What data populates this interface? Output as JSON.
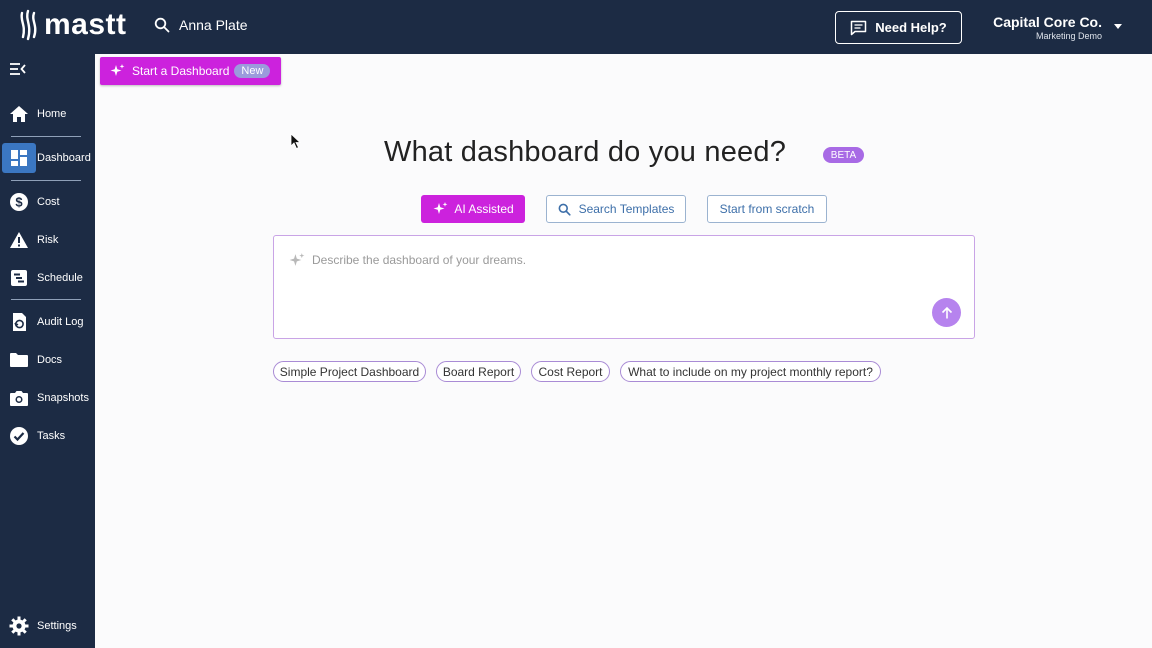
{
  "app": {
    "logo_text": "mastt"
  },
  "header": {
    "search_value": "Anna Plate",
    "help_label": "Need Help?",
    "company_name": "Capital Core Co.",
    "company_sub": "Marketing Demo"
  },
  "sidebar": {
    "items": [
      {
        "label": "Home",
        "icon": "home-icon"
      },
      {
        "label": "Dashboard",
        "icon": "dashboard-icon",
        "active": true
      },
      {
        "label": "Cost",
        "icon": "dollar-icon"
      },
      {
        "label": "Risk",
        "icon": "warning-icon"
      },
      {
        "label": "Schedule",
        "icon": "schedule-icon"
      },
      {
        "label": "Audit Log",
        "icon": "history-icon"
      },
      {
        "label": "Docs",
        "icon": "folder-icon"
      },
      {
        "label": "Snapshots",
        "icon": "camera-icon"
      },
      {
        "label": "Tasks",
        "icon": "check-circle-icon"
      },
      {
        "label": "Settings",
        "icon": "gear-icon"
      }
    ]
  },
  "toolbar": {
    "start_label": "Start a Dashboard",
    "new_badge": "New"
  },
  "main": {
    "headline": "What dashboard do you need?",
    "beta_badge": "BETA",
    "modes": {
      "ai": "AI Assisted",
      "search": "Search Templates",
      "scratch": "Start from scratch"
    },
    "prompt_placeholder": "Describe the dashboard of your dreams.",
    "suggestions": [
      "Simple Project Dashboard",
      "Board Report",
      "Cost Report",
      "What to include on my project monthly report?"
    ]
  },
  "colors": {
    "navy": "#1c2b44",
    "accent_magenta": "#cc22dd",
    "active_blue": "#3b77c2",
    "beta_purple": "#a86ae5",
    "link_blue": "#3d6fa9"
  }
}
